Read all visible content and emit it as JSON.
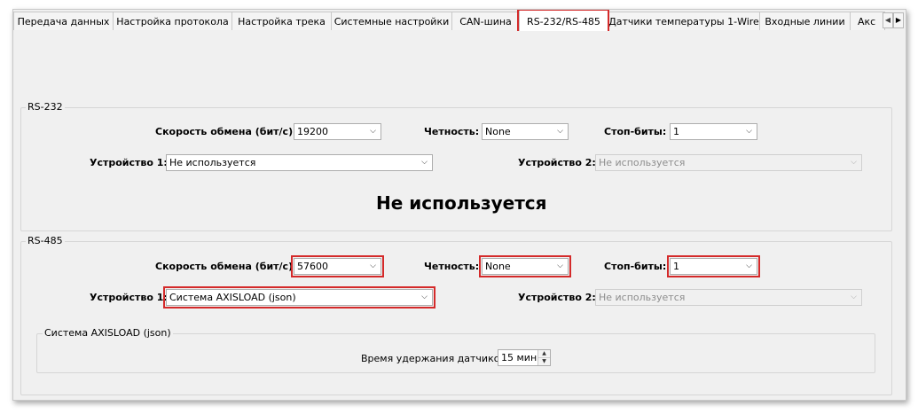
{
  "tabs": [
    "Передача данных",
    "Настройка протокола",
    "Настройка трека",
    "Системные настройки",
    "CAN-шина",
    "RS-232/RS-485",
    "Датчики температуры 1-Wire",
    "Входные линии",
    "Акс"
  ],
  "active_tab": "RS-232/RS-485",
  "rs232": {
    "title": "RS-232",
    "speed_label": "Скорость обмена (бит/с):",
    "speed_value": "19200",
    "parity_label": "Четность:",
    "parity_value": "None",
    "stopbits_label": "Стоп-биты:",
    "stopbits_value": "1",
    "device1_label": "Устройство 1:",
    "device1_value": "Не используется",
    "device2_label": "Устройство 2:",
    "device2_value": "Не используется",
    "status_text": "Не используется"
  },
  "rs485": {
    "title": "RS-485",
    "speed_label": "Скорость обмена (бит/с):",
    "speed_value": "57600",
    "parity_label": "Четность:",
    "parity_value": "None",
    "stopbits_label": "Стоп-биты:",
    "stopbits_value": "1",
    "device1_label": "Устройство 1:",
    "device1_value": "Система AXISLOAD (json)",
    "device2_label": "Устройство 2:",
    "device2_value": "Не используется",
    "subgroup_title": "Система AXISLOAD (json)",
    "hold_label": "Время удержания датчиков:",
    "hold_value": "15 мин"
  },
  "icons": {
    "combo_arrow": "chevron-down-icon",
    "tab_scroll_left": "triangle-left-icon",
    "tab_scroll_right": "triangle-right-icon"
  },
  "colors": {
    "highlight": "#d42a2a",
    "window_bg": "#f0f0f0"
  }
}
